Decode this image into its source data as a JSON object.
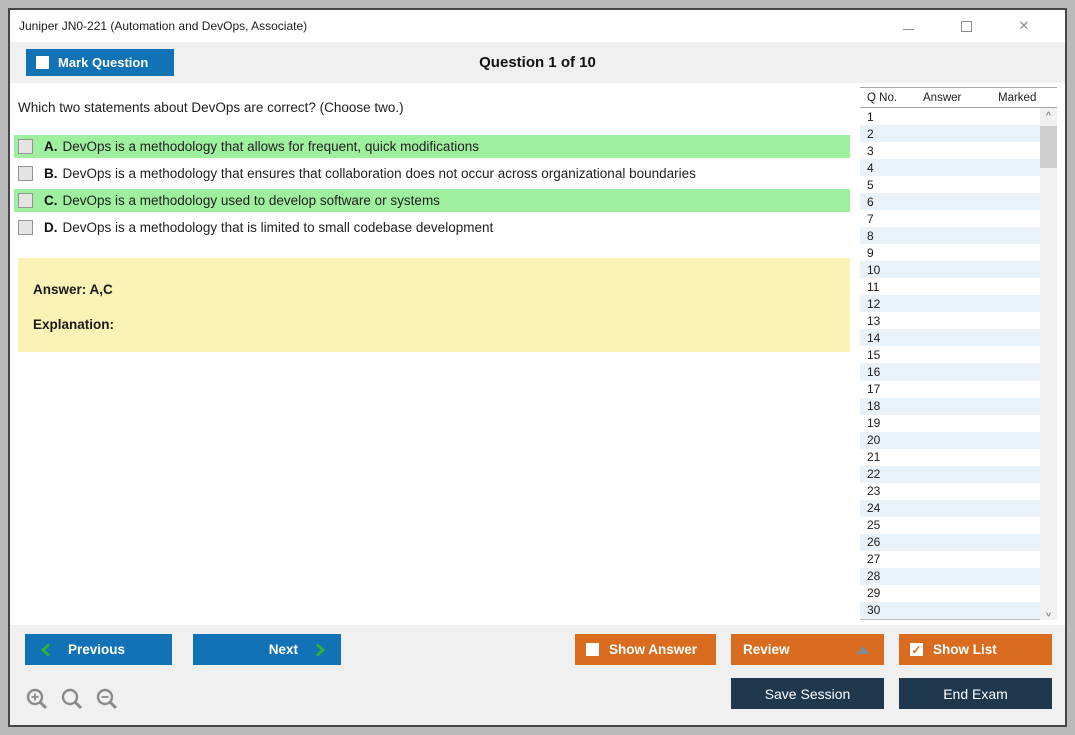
{
  "window": {
    "title": "Juniper JN0-221 (Automation and DevOps, Associate)",
    "icons": {
      "close": "✕"
    }
  },
  "header": {
    "mark_question_label": "Mark Question",
    "question_counter": "Question 1 of 10"
  },
  "question": {
    "text": "Which two statements about DevOps are correct? (Choose two.)",
    "options": [
      {
        "letter": "A.",
        "text": "DevOps is a methodology that allows for frequent, quick modifications",
        "highlighted": true,
        "checked": false
      },
      {
        "letter": "B.",
        "text": "DevOps is a methodology that ensures that collaboration does not occur across organizational boundaries",
        "highlighted": false,
        "checked": false
      },
      {
        "letter": "C.",
        "text": "DevOps is a methodology used to develop software or systems",
        "highlighted": true,
        "checked": false
      },
      {
        "letter": "D.",
        "text": "DevOps is a methodology that is limited to small codebase development",
        "highlighted": false,
        "checked": false
      }
    ],
    "answer_label": "Answer: A,C",
    "explanation_label": "Explanation:"
  },
  "question_list": {
    "columns": [
      "Q No.",
      "Answer",
      "Marked"
    ],
    "rows": [
      "1",
      "2",
      "3",
      "4",
      "5",
      "6",
      "7",
      "8",
      "9",
      "10",
      "11",
      "12",
      "13",
      "14",
      "15",
      "16",
      "17",
      "18",
      "19",
      "20",
      "21",
      "22",
      "23",
      "24",
      "25",
      "26",
      "27",
      "28",
      "29",
      "30"
    ],
    "scroll_up_glyph": "^"
  },
  "footer": {
    "previous_label": "Previous",
    "next_label": "Next",
    "show_answer_label": "Show Answer",
    "show_answer_checked": false,
    "review_label": "Review",
    "show_list_label": "Show List",
    "show_list_checked": true,
    "check_glyph": "✓",
    "save_session_label": "Save Session",
    "end_exam_label": "End Exam"
  },
  "colors": {
    "accent_blue": "#1272b6",
    "accent_orange": "#d96c1f",
    "accent_navy": "#20384e",
    "highlight_green": "#9ff09e",
    "answer_yellow": "#fbf2b5",
    "row_alt_blue": "#e9f1f9",
    "chevron_green": "#2db52d"
  }
}
